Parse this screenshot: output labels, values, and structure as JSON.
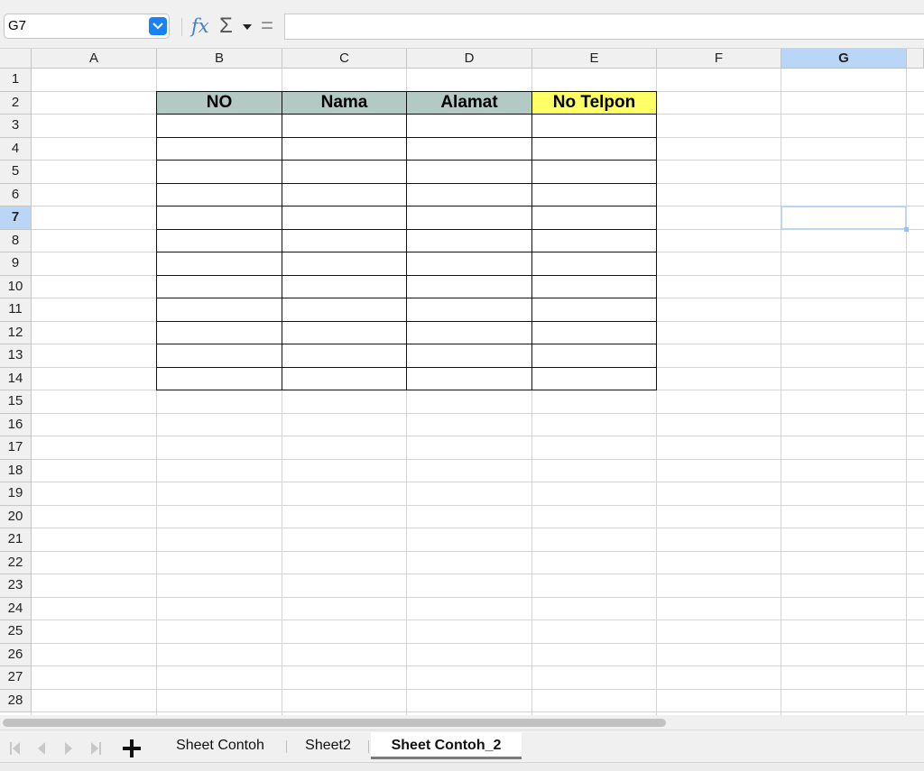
{
  "formula_bar": {
    "cell_reference": "G7",
    "formula_value": "",
    "fx_label": "fx",
    "sigma_label": "Σ",
    "equals_label": "="
  },
  "columns": [
    "A",
    "B",
    "C",
    "D",
    "E",
    "F",
    "G"
  ],
  "selected_column": "G",
  "rows": [
    "1",
    "2",
    "3",
    "4",
    "5",
    "6",
    "7",
    "8",
    "9",
    "10",
    "11",
    "12",
    "13",
    "14",
    "15",
    "16",
    "17",
    "18",
    "19",
    "20",
    "21",
    "22",
    "23",
    "24",
    "25",
    "26",
    "27",
    "28"
  ],
  "selected_row": "7",
  "table": {
    "headers": [
      "NO",
      "Nama",
      "Alamat",
      "No Telpon"
    ],
    "header_colors": [
      "#b3c9c3",
      "#b3c9c3",
      "#b3c9c3",
      "#ffff66"
    ],
    "empty_rows": 12
  },
  "sheet_tabs": [
    {
      "label": "Sheet Contoh",
      "active": false
    },
    {
      "label": "Sheet2",
      "active": false
    },
    {
      "label": "Sheet Contoh_2",
      "active": true
    }
  ],
  "icons": {
    "name_box_dropdown": "chevron-down-icon",
    "add_sheet": "plus-icon",
    "nav_first": "first-sheet-icon",
    "nav_prev": "prev-sheet-icon",
    "nav_next": "next-sheet-icon",
    "nav_last": "last-sheet-icon"
  }
}
